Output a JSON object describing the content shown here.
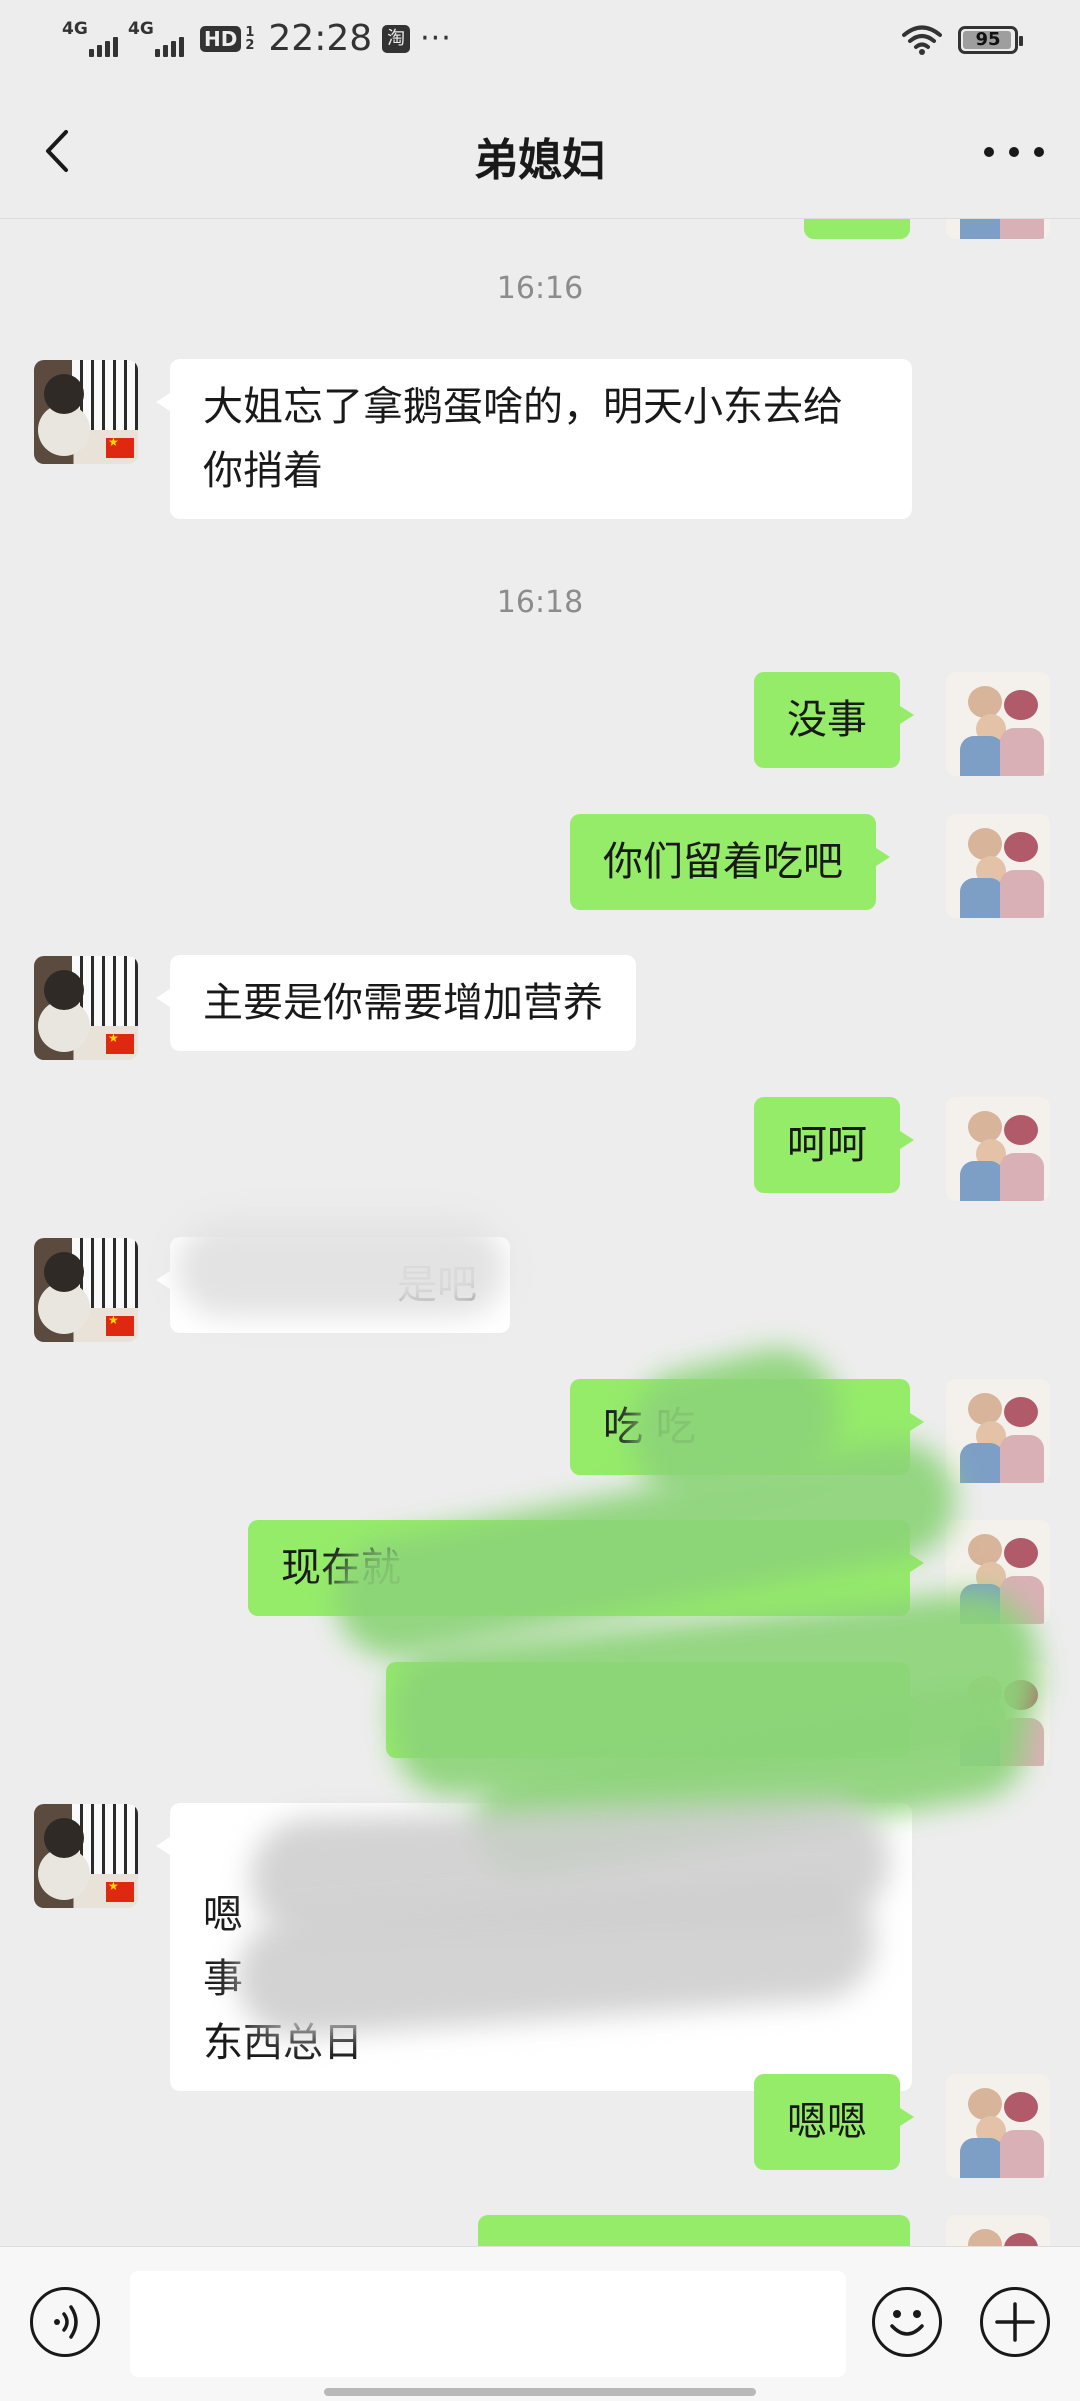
{
  "status_bar": {
    "sim1": "4G",
    "sim2": "4G",
    "hd": "HD",
    "hd_sub_top": "1",
    "hd_sub_bottom": "2",
    "time": "22:28",
    "app_icon": "淘",
    "more": "···",
    "wifi_icon": "wifi-icon",
    "battery_level": "95",
    "battery_fraction": 0.95
  },
  "nav": {
    "title": "弟媳妇",
    "back_icon": "chevron-left-icon",
    "more_icon": "more-dots-icon"
  },
  "timestamps": [
    "16:16",
    "16:18"
  ],
  "messages": [
    {
      "side": "in",
      "text": "大姐忘了拿鹅蛋啥的，明天小东去给你捎着"
    },
    {
      "side": "out",
      "text": "没事"
    },
    {
      "side": "out",
      "text": "你们留着吃吧"
    },
    {
      "side": "in",
      "text": "主要是你需要增加营养"
    },
    {
      "side": "out",
      "text": "呵呵"
    },
    {
      "side": "in",
      "text": "是吧",
      "redacted": true
    },
    {
      "side": "out",
      "text": "吃 吃",
      "redacted": true
    },
    {
      "side": "out",
      "text": "现在就",
      "redacted": true
    },
    {
      "side": "out",
      "text": "",
      "redacted": true
    },
    {
      "side": "in",
      "text": "嗯\n事\n东西总日",
      "redacted": true
    },
    {
      "side": "out",
      "text": "嗯嗯"
    },
    {
      "side": "out",
      "text": "",
      "partially_visible": true
    }
  ],
  "input_bar": {
    "voice_icon": "voice-icon",
    "text_value": "",
    "emoji_icon": "emoji-icon",
    "plus_icon": "plus-icon"
  },
  "colors": {
    "background": "#ededed",
    "outgoing_bubble": "#95ec69",
    "incoming_bubble": "#ffffff",
    "timestamp": "#8c8c8c"
  }
}
